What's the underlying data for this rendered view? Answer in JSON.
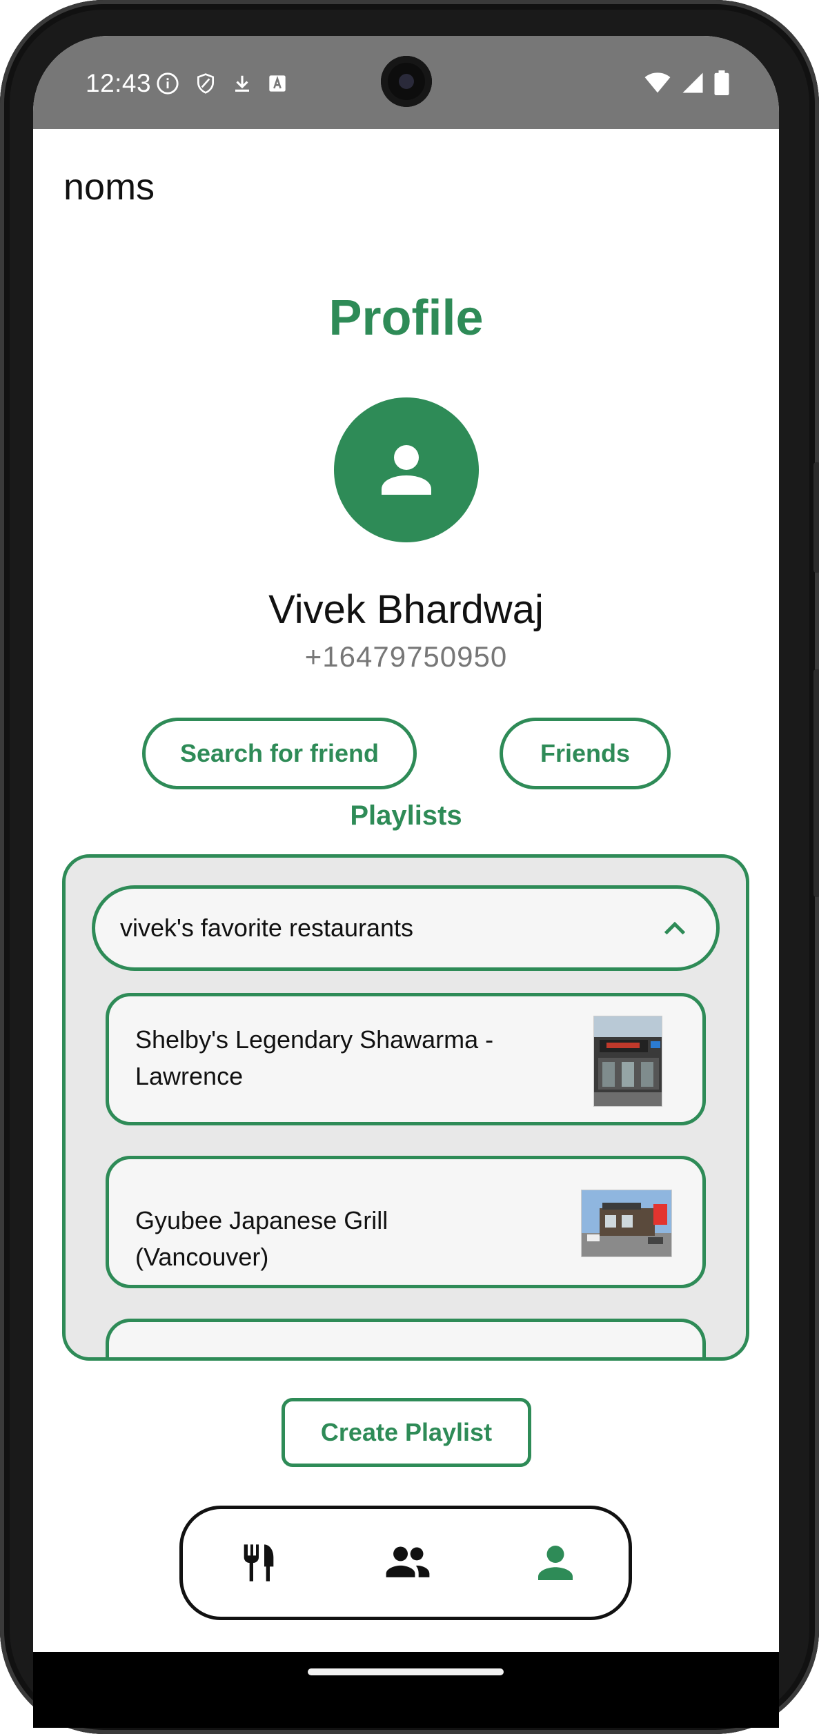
{
  "status_bar": {
    "time": "12:43",
    "icons_left": [
      "info-icon",
      "shield-icon",
      "download-icon",
      "a-box-icon"
    ],
    "icons_right": [
      "wifi-icon",
      "signal-icon",
      "battery-icon"
    ]
  },
  "app": {
    "title": "noms",
    "accent_color": "#2e8b57"
  },
  "profile": {
    "heading": "Profile",
    "avatar_icon": "person-icon",
    "name": "Vivek Bhardwaj",
    "phone": "+16479750950"
  },
  "actions": {
    "search_friend_label": "Search for friend",
    "friends_label": "Friends",
    "create_playlist_label": "Create Playlist"
  },
  "playlists": {
    "label": "Playlists",
    "items": [
      {
        "title": "vivek's favorite restaurants",
        "expanded": true,
        "restaurants": [
          {
            "name": "Shelby's Legendary Shawarma - Lawrence"
          },
          {
            "name": "Gyubee Japanese Grill (Vancouver)"
          },
          {
            "name": ""
          }
        ]
      }
    ]
  },
  "bottom_nav": {
    "items": [
      {
        "icon": "restaurant-icon",
        "active": false
      },
      {
        "icon": "group-icon",
        "active": false
      },
      {
        "icon": "person-icon",
        "active": true
      }
    ]
  }
}
